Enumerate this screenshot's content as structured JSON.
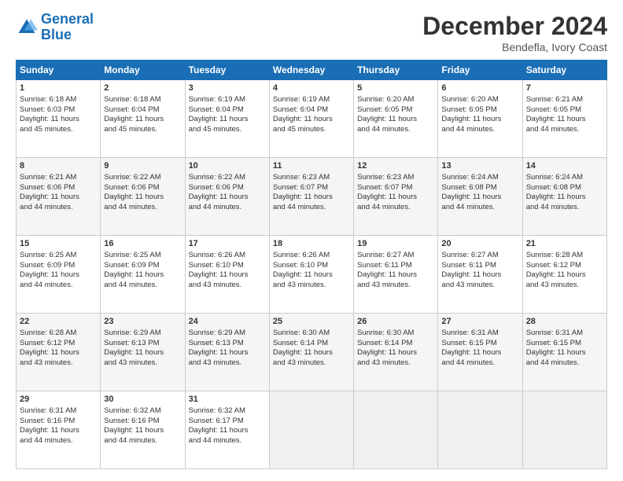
{
  "header": {
    "logo_line1": "General",
    "logo_line2": "Blue",
    "title": "December 2024",
    "subtitle": "Bendefla, Ivory Coast"
  },
  "calendar": {
    "days_of_week": [
      "Sunday",
      "Monday",
      "Tuesday",
      "Wednesday",
      "Thursday",
      "Friday",
      "Saturday"
    ],
    "weeks": [
      [
        {
          "day": "",
          "empty": true
        },
        {
          "day": "",
          "empty": true
        },
        {
          "day": "",
          "empty": true
        },
        {
          "day": "",
          "empty": true
        },
        {
          "day": "",
          "empty": true
        },
        {
          "day": "",
          "empty": true
        },
        {
          "day": "",
          "empty": true
        }
      ],
      [
        {
          "day": "1",
          "lines": [
            "Sunrise: 6:18 AM",
            "Sunset: 6:03 PM",
            "Daylight: 11 hours",
            "and 45 minutes."
          ]
        },
        {
          "day": "2",
          "lines": [
            "Sunrise: 6:18 AM",
            "Sunset: 6:04 PM",
            "Daylight: 11 hours",
            "and 45 minutes."
          ]
        },
        {
          "day": "3",
          "lines": [
            "Sunrise: 6:19 AM",
            "Sunset: 6:04 PM",
            "Daylight: 11 hours",
            "and 45 minutes."
          ]
        },
        {
          "day": "4",
          "lines": [
            "Sunrise: 6:19 AM",
            "Sunset: 6:04 PM",
            "Daylight: 11 hours",
            "and 45 minutes."
          ]
        },
        {
          "day": "5",
          "lines": [
            "Sunrise: 6:20 AM",
            "Sunset: 6:05 PM",
            "Daylight: 11 hours",
            "and 44 minutes."
          ]
        },
        {
          "day": "6",
          "lines": [
            "Sunrise: 6:20 AM",
            "Sunset: 6:05 PM",
            "Daylight: 11 hours",
            "and 44 minutes."
          ]
        },
        {
          "day": "7",
          "lines": [
            "Sunrise: 6:21 AM",
            "Sunset: 6:05 PM",
            "Daylight: 11 hours",
            "and 44 minutes."
          ]
        }
      ],
      [
        {
          "day": "8",
          "lines": [
            "Sunrise: 6:21 AM",
            "Sunset: 6:06 PM",
            "Daylight: 11 hours",
            "and 44 minutes."
          ]
        },
        {
          "day": "9",
          "lines": [
            "Sunrise: 6:22 AM",
            "Sunset: 6:06 PM",
            "Daylight: 11 hours",
            "and 44 minutes."
          ]
        },
        {
          "day": "10",
          "lines": [
            "Sunrise: 6:22 AM",
            "Sunset: 6:06 PM",
            "Daylight: 11 hours",
            "and 44 minutes."
          ]
        },
        {
          "day": "11",
          "lines": [
            "Sunrise: 6:23 AM",
            "Sunset: 6:07 PM",
            "Daylight: 11 hours",
            "and 44 minutes."
          ]
        },
        {
          "day": "12",
          "lines": [
            "Sunrise: 6:23 AM",
            "Sunset: 6:07 PM",
            "Daylight: 11 hours",
            "and 44 minutes."
          ]
        },
        {
          "day": "13",
          "lines": [
            "Sunrise: 6:24 AM",
            "Sunset: 6:08 PM",
            "Daylight: 11 hours",
            "and 44 minutes."
          ]
        },
        {
          "day": "14",
          "lines": [
            "Sunrise: 6:24 AM",
            "Sunset: 6:08 PM",
            "Daylight: 11 hours",
            "and 44 minutes."
          ]
        }
      ],
      [
        {
          "day": "15",
          "lines": [
            "Sunrise: 6:25 AM",
            "Sunset: 6:09 PM",
            "Daylight: 11 hours",
            "and 44 minutes."
          ]
        },
        {
          "day": "16",
          "lines": [
            "Sunrise: 6:25 AM",
            "Sunset: 6:09 PM",
            "Daylight: 11 hours",
            "and 44 minutes."
          ]
        },
        {
          "day": "17",
          "lines": [
            "Sunrise: 6:26 AM",
            "Sunset: 6:10 PM",
            "Daylight: 11 hours",
            "and 43 minutes."
          ]
        },
        {
          "day": "18",
          "lines": [
            "Sunrise: 6:26 AM",
            "Sunset: 6:10 PM",
            "Daylight: 11 hours",
            "and 43 minutes."
          ]
        },
        {
          "day": "19",
          "lines": [
            "Sunrise: 6:27 AM",
            "Sunset: 6:11 PM",
            "Daylight: 11 hours",
            "and 43 minutes."
          ]
        },
        {
          "day": "20",
          "lines": [
            "Sunrise: 6:27 AM",
            "Sunset: 6:11 PM",
            "Daylight: 11 hours",
            "and 43 minutes."
          ]
        },
        {
          "day": "21",
          "lines": [
            "Sunrise: 6:28 AM",
            "Sunset: 6:12 PM",
            "Daylight: 11 hours",
            "and 43 minutes."
          ]
        }
      ],
      [
        {
          "day": "22",
          "lines": [
            "Sunrise: 6:28 AM",
            "Sunset: 6:12 PM",
            "Daylight: 11 hours",
            "and 43 minutes."
          ]
        },
        {
          "day": "23",
          "lines": [
            "Sunrise: 6:29 AM",
            "Sunset: 6:13 PM",
            "Daylight: 11 hours",
            "and 43 minutes."
          ]
        },
        {
          "day": "24",
          "lines": [
            "Sunrise: 6:29 AM",
            "Sunset: 6:13 PM",
            "Daylight: 11 hours",
            "and 43 minutes."
          ]
        },
        {
          "day": "25",
          "lines": [
            "Sunrise: 6:30 AM",
            "Sunset: 6:14 PM",
            "Daylight: 11 hours",
            "and 43 minutes."
          ]
        },
        {
          "day": "26",
          "lines": [
            "Sunrise: 6:30 AM",
            "Sunset: 6:14 PM",
            "Daylight: 11 hours",
            "and 43 minutes."
          ]
        },
        {
          "day": "27",
          "lines": [
            "Sunrise: 6:31 AM",
            "Sunset: 6:15 PM",
            "Daylight: 11 hours",
            "and 44 minutes."
          ]
        },
        {
          "day": "28",
          "lines": [
            "Sunrise: 6:31 AM",
            "Sunset: 6:15 PM",
            "Daylight: 11 hours",
            "and 44 minutes."
          ]
        }
      ],
      [
        {
          "day": "29",
          "lines": [
            "Sunrise: 6:31 AM",
            "Sunset: 6:16 PM",
            "Daylight: 11 hours",
            "and 44 minutes."
          ]
        },
        {
          "day": "30",
          "lines": [
            "Sunrise: 6:32 AM",
            "Sunset: 6:16 PM",
            "Daylight: 11 hours",
            "and 44 minutes."
          ]
        },
        {
          "day": "31",
          "lines": [
            "Sunrise: 6:32 AM",
            "Sunset: 6:17 PM",
            "Daylight: 11 hours",
            "and 44 minutes."
          ]
        },
        {
          "day": "",
          "empty": true
        },
        {
          "day": "",
          "empty": true
        },
        {
          "day": "",
          "empty": true
        },
        {
          "day": "",
          "empty": true
        }
      ]
    ]
  }
}
